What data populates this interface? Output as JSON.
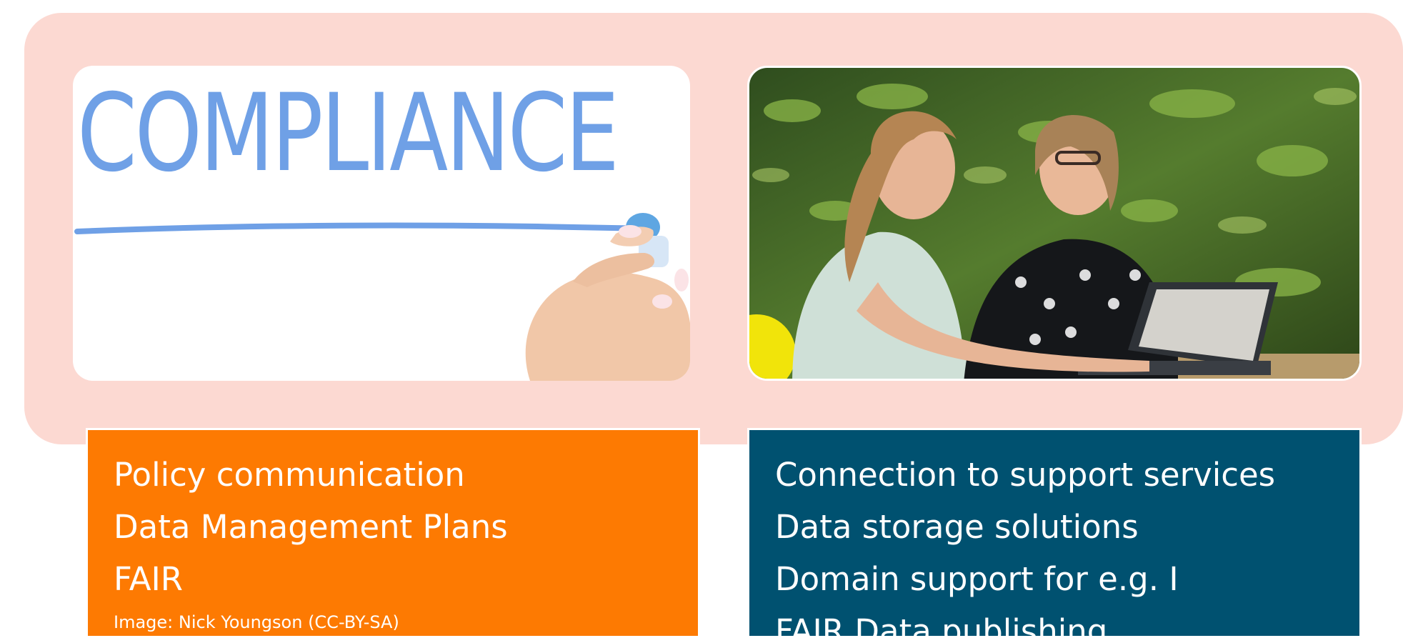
{
  "left": {
    "image_text": "COMPLIANCE",
    "items": [
      "Policy communication",
      "Data Management Plans",
      "FAIR"
    ],
    "credit": "Image: Nick Youngson (CC-BY-SA)"
  },
  "right": {
    "items": [
      "Connection to support services",
      "Data storage solutions",
      "Domain support for e.g. I",
      "FAIR Data publishing"
    ]
  },
  "colors": {
    "backdrop": "#fcd9d2",
    "orange": "#fd7a02",
    "blue": "#005170",
    "compliance_blue": "#6fa0e6"
  }
}
